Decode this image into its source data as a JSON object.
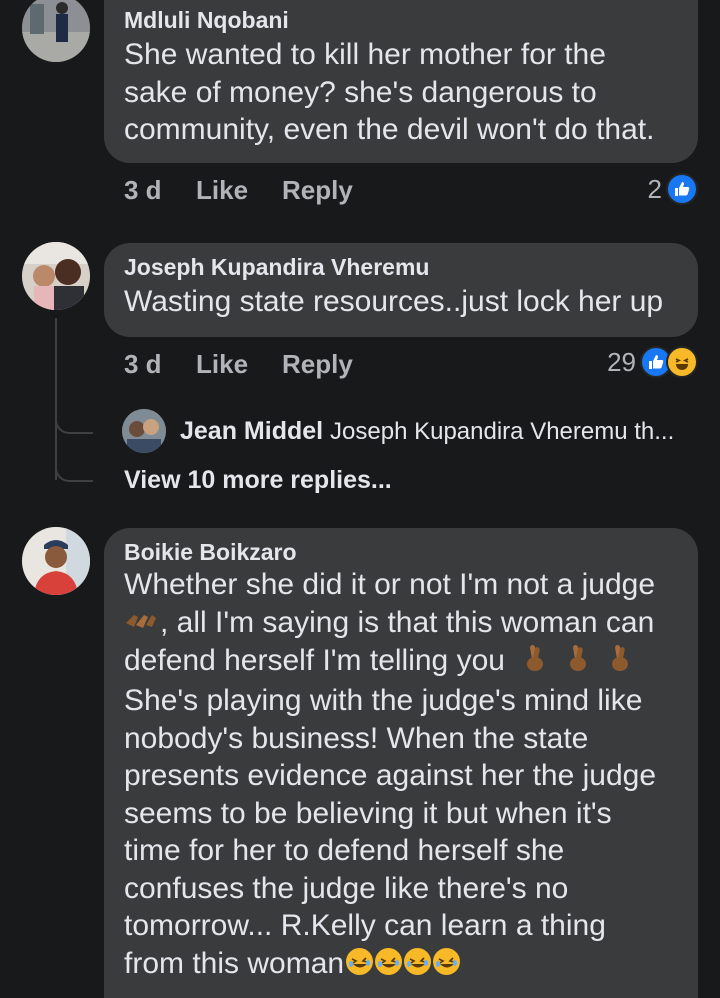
{
  "comments": [
    {
      "author": "Mdluli Nqobani",
      "lines": [
        "She wanted to kill her mother for the",
        "sake of money? she's dangerous to",
        "community, even the devil won't do that."
      ],
      "time": "3 d",
      "like_label": "Like",
      "reply_label": "Reply",
      "reaction_count": "2"
    },
    {
      "author": "Joseph Kupandira Vheremu",
      "lines": [
        "Wasting state resources..just lock her up"
      ],
      "time": "3 d",
      "like_label": "Like",
      "reply_label": "Reply",
      "reaction_count": "29",
      "reply_preview": {
        "author": "Jean Middel",
        "text": "Joseph Kupandira Vheremu th..."
      },
      "view_more": "View 10 more replies..."
    },
    {
      "author": "Boikie Boikzaro",
      "lines": [
        "Whether she did it or not I'm not a judge",
        ", all I'm saying is that this woman can",
        "defend herself I'm telling you",
        "She's playing with the judge's mind like",
        "nobody's business! When the state",
        "presents evidence against her the judge",
        "seems to be believing it but when it's",
        "time for her to defend herself she",
        "confuses the judge like there's no",
        "tomorrow... R.Kelly can learn a thing",
        "from this woman"
      ]
    }
  ],
  "colors": {
    "background": "#18191a",
    "bubble": "#3a3b3c",
    "text": "#e4e6eb",
    "muted": "#b0b3b8",
    "like_blue": "#1877f2",
    "haha_yellow": "#f7b928"
  },
  "icons": [
    "thumbs-up-icon",
    "haha-icon",
    "clapping-hands-emoji",
    "crossed-fingers-emoji",
    "rolling-laughing-emoji"
  ]
}
